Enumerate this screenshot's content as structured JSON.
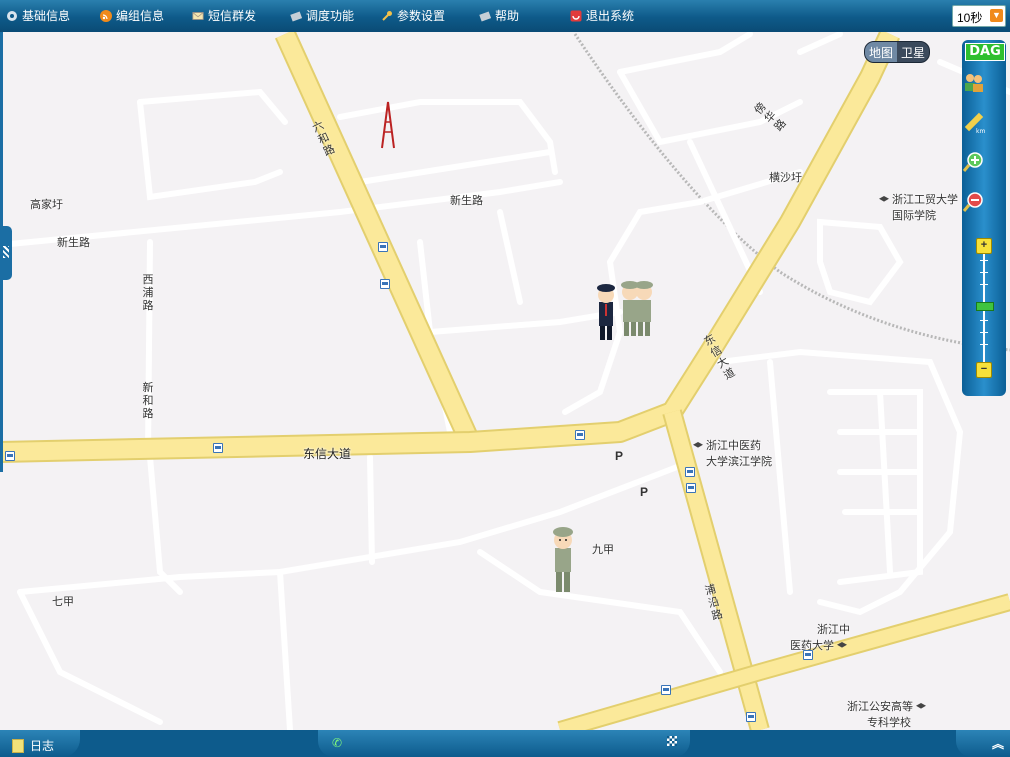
{
  "menu": [
    {
      "label": "基础信息",
      "icon": "gear-icon"
    },
    {
      "label": "编组信息",
      "icon": "rss-icon"
    },
    {
      "label": "短信群发",
      "icon": "envelope-icon"
    },
    {
      "label": "调度功能",
      "icon": "dispatch-icon"
    },
    {
      "label": "参数设置",
      "icon": "wrench-icon"
    },
    {
      "label": "帮助",
      "icon": "help-icon"
    },
    {
      "label": "退出系统",
      "icon": "exit-icon"
    }
  ],
  "refresh_interval": "10秒",
  "map_switch": {
    "map": "地图",
    "satellite": "卫星",
    "active": "map"
  },
  "tool_panel": {
    "logo": "DAG",
    "tools": [
      "users-icon",
      "ruler-icon",
      "zoom-in-icon",
      "zoom-out-icon"
    ],
    "zoom_level_fraction": 0.5
  },
  "streets": {
    "liuhe": "六和路",
    "xinsheng1": "新生路",
    "xinsheng2": "新生路",
    "xipu": "西浦路",
    "xinhe": "新和路",
    "dongxin": "东信大道",
    "dongxin_v": "东信大道",
    "puyan": "浦沿路",
    "yuehua": "傍华路"
  },
  "places": {
    "gaojiayu": "高家圩",
    "hengshayu": "横沙圩",
    "zjmy_1": "浙江工贸大学",
    "zjmy_2": "国际学院",
    "tcm_1": "浙江中医药",
    "tcm_2": "大学滨江学院",
    "jiujia": "九甲",
    "qijia": "七甲",
    "tcm2_1": "浙江中",
    "tcm2_2": "医药大学",
    "police_1": "浙江公安高等",
    "police_2": "专科学校"
  },
  "parking_label": "P",
  "bottom": {
    "log": "日志"
  },
  "colors": {
    "topbar": "#0e5a89",
    "road_major": "#fbe99a",
    "road_major_edge": "#e3cf6e",
    "road_minor": "#ffffff",
    "map_bg": "#f4f2f4",
    "panel": "#1f7fbd"
  }
}
